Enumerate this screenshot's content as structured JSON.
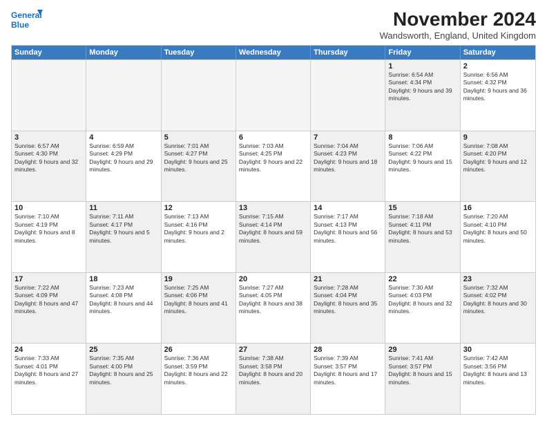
{
  "logo": {
    "line1": "General",
    "line2": "Blue"
  },
  "title": "November 2024",
  "subtitle": "Wandsworth, England, United Kingdom",
  "header_days": [
    "Sunday",
    "Monday",
    "Tuesday",
    "Wednesday",
    "Thursday",
    "Friday",
    "Saturday"
  ],
  "rows": [
    [
      {
        "day": "",
        "info": "",
        "shaded": false,
        "empty": true
      },
      {
        "day": "",
        "info": "",
        "shaded": false,
        "empty": true
      },
      {
        "day": "",
        "info": "",
        "shaded": false,
        "empty": true
      },
      {
        "day": "",
        "info": "",
        "shaded": false,
        "empty": true
      },
      {
        "day": "",
        "info": "",
        "shaded": false,
        "empty": true
      },
      {
        "day": "1",
        "info": "Sunrise: 6:54 AM\nSunset: 4:34 PM\nDaylight: 9 hours and 39 minutes.",
        "shaded": true,
        "empty": false
      },
      {
        "day": "2",
        "info": "Sunrise: 6:56 AM\nSunset: 4:32 PM\nDaylight: 9 hours and 36 minutes.",
        "shaded": false,
        "empty": false
      }
    ],
    [
      {
        "day": "3",
        "info": "Sunrise: 6:57 AM\nSunset: 4:30 PM\nDaylight: 9 hours and 32 minutes.",
        "shaded": true,
        "empty": false
      },
      {
        "day": "4",
        "info": "Sunrise: 6:59 AM\nSunset: 4:29 PM\nDaylight: 9 hours and 29 minutes.",
        "shaded": false,
        "empty": false
      },
      {
        "day": "5",
        "info": "Sunrise: 7:01 AM\nSunset: 4:27 PM\nDaylight: 9 hours and 25 minutes.",
        "shaded": true,
        "empty": false
      },
      {
        "day": "6",
        "info": "Sunrise: 7:03 AM\nSunset: 4:25 PM\nDaylight: 9 hours and 22 minutes.",
        "shaded": false,
        "empty": false
      },
      {
        "day": "7",
        "info": "Sunrise: 7:04 AM\nSunset: 4:23 PM\nDaylight: 9 hours and 18 minutes.",
        "shaded": true,
        "empty": false
      },
      {
        "day": "8",
        "info": "Sunrise: 7:06 AM\nSunset: 4:22 PM\nDaylight: 9 hours and 15 minutes.",
        "shaded": false,
        "empty": false
      },
      {
        "day": "9",
        "info": "Sunrise: 7:08 AM\nSunset: 4:20 PM\nDaylight: 9 hours and 12 minutes.",
        "shaded": true,
        "empty": false
      }
    ],
    [
      {
        "day": "10",
        "info": "Sunrise: 7:10 AM\nSunset: 4:19 PM\nDaylight: 9 hours and 8 minutes.",
        "shaded": false,
        "empty": false
      },
      {
        "day": "11",
        "info": "Sunrise: 7:11 AM\nSunset: 4:17 PM\nDaylight: 9 hours and 5 minutes.",
        "shaded": true,
        "empty": false
      },
      {
        "day": "12",
        "info": "Sunrise: 7:13 AM\nSunset: 4:16 PM\nDaylight: 9 hours and 2 minutes.",
        "shaded": false,
        "empty": false
      },
      {
        "day": "13",
        "info": "Sunrise: 7:15 AM\nSunset: 4:14 PM\nDaylight: 8 hours and 59 minutes.",
        "shaded": true,
        "empty": false
      },
      {
        "day": "14",
        "info": "Sunrise: 7:17 AM\nSunset: 4:13 PM\nDaylight: 8 hours and 56 minutes.",
        "shaded": false,
        "empty": false
      },
      {
        "day": "15",
        "info": "Sunrise: 7:18 AM\nSunset: 4:11 PM\nDaylight: 8 hours and 53 minutes.",
        "shaded": true,
        "empty": false
      },
      {
        "day": "16",
        "info": "Sunrise: 7:20 AM\nSunset: 4:10 PM\nDaylight: 8 hours and 50 minutes.",
        "shaded": false,
        "empty": false
      }
    ],
    [
      {
        "day": "17",
        "info": "Sunrise: 7:22 AM\nSunset: 4:09 PM\nDaylight: 8 hours and 47 minutes.",
        "shaded": true,
        "empty": false
      },
      {
        "day": "18",
        "info": "Sunrise: 7:23 AM\nSunset: 4:08 PM\nDaylight: 8 hours and 44 minutes.",
        "shaded": false,
        "empty": false
      },
      {
        "day": "19",
        "info": "Sunrise: 7:25 AM\nSunset: 4:06 PM\nDaylight: 8 hours and 41 minutes.",
        "shaded": true,
        "empty": false
      },
      {
        "day": "20",
        "info": "Sunrise: 7:27 AM\nSunset: 4:05 PM\nDaylight: 8 hours and 38 minutes.",
        "shaded": false,
        "empty": false
      },
      {
        "day": "21",
        "info": "Sunrise: 7:28 AM\nSunset: 4:04 PM\nDaylight: 8 hours and 35 minutes.",
        "shaded": true,
        "empty": false
      },
      {
        "day": "22",
        "info": "Sunrise: 7:30 AM\nSunset: 4:03 PM\nDaylight: 8 hours and 32 minutes.",
        "shaded": false,
        "empty": false
      },
      {
        "day": "23",
        "info": "Sunrise: 7:32 AM\nSunset: 4:02 PM\nDaylight: 8 hours and 30 minutes.",
        "shaded": true,
        "empty": false
      }
    ],
    [
      {
        "day": "24",
        "info": "Sunrise: 7:33 AM\nSunset: 4:01 PM\nDaylight: 8 hours and 27 minutes.",
        "shaded": false,
        "empty": false
      },
      {
        "day": "25",
        "info": "Sunrise: 7:35 AM\nSunset: 4:00 PM\nDaylight: 8 hours and 25 minutes.",
        "shaded": true,
        "empty": false
      },
      {
        "day": "26",
        "info": "Sunrise: 7:36 AM\nSunset: 3:59 PM\nDaylight: 8 hours and 22 minutes.",
        "shaded": false,
        "empty": false
      },
      {
        "day": "27",
        "info": "Sunrise: 7:38 AM\nSunset: 3:58 PM\nDaylight: 8 hours and 20 minutes.",
        "shaded": true,
        "empty": false
      },
      {
        "day": "28",
        "info": "Sunrise: 7:39 AM\nSunset: 3:57 PM\nDaylight: 8 hours and 17 minutes.",
        "shaded": false,
        "empty": false
      },
      {
        "day": "29",
        "info": "Sunrise: 7:41 AM\nSunset: 3:57 PM\nDaylight: 8 hours and 15 minutes.",
        "shaded": true,
        "empty": false
      },
      {
        "day": "30",
        "info": "Sunrise: 7:42 AM\nSunset: 3:56 PM\nDaylight: 8 hours and 13 minutes.",
        "shaded": false,
        "empty": false
      }
    ]
  ]
}
